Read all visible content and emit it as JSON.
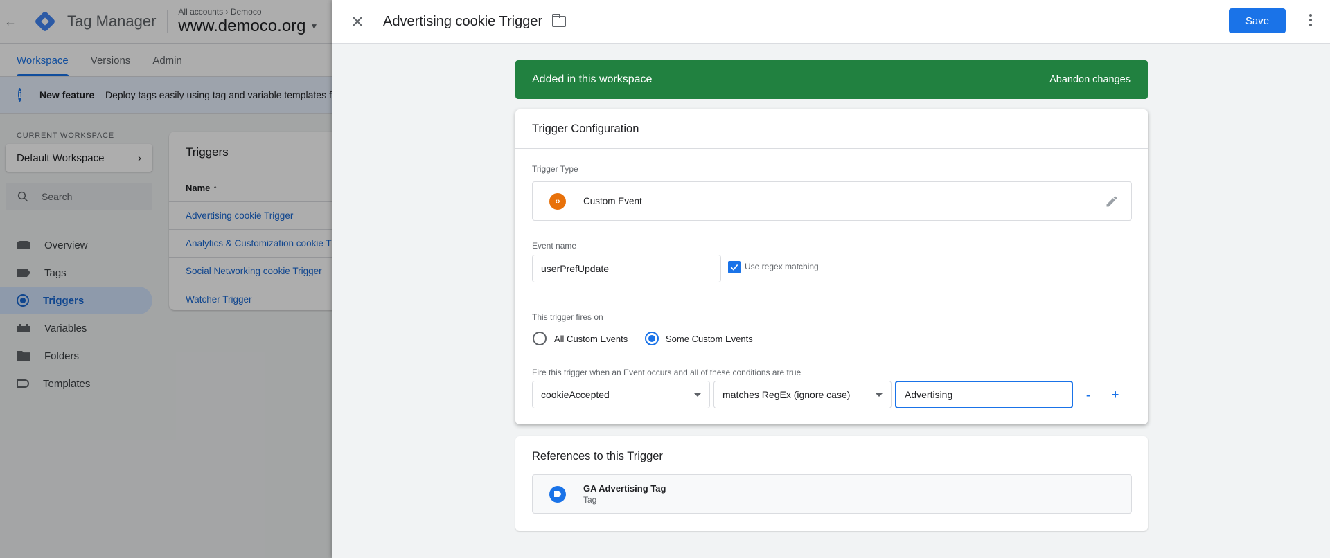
{
  "app": {
    "name": "Tag Manager",
    "breadcrumb": [
      "All accounts",
      "Democo"
    ],
    "container": "www.democo.org"
  },
  "nav_tabs": [
    {
      "label": "Workspace",
      "active": true
    },
    {
      "label": "Versions",
      "active": false
    },
    {
      "label": "Admin",
      "active": false
    }
  ],
  "banner": {
    "title": "New feature",
    "text": "– Deploy tags easily using tag and variable templates fr"
  },
  "workspace": {
    "section_label": "CURRENT WORKSPACE",
    "name": "Default Workspace"
  },
  "search": {
    "placeholder": "Search"
  },
  "sidebar": {
    "items": [
      {
        "label": "Overview",
        "icon": "overview-icon",
        "active": false
      },
      {
        "label": "Tags",
        "icon": "tag-icon",
        "active": false
      },
      {
        "label": "Triggers",
        "icon": "trigger-icon",
        "active": true
      },
      {
        "label": "Variables",
        "icon": "variables-icon",
        "active": false
      },
      {
        "label": "Folders",
        "icon": "folder-icon",
        "active": false
      },
      {
        "label": "Templates",
        "icon": "templates-icon",
        "active": false
      }
    ]
  },
  "triggers_list": {
    "title": "Triggers",
    "column_name": "Name",
    "sort_icon": "arrow-up-icon",
    "rows": [
      "Advertising cookie Trigger",
      "Analytics & Customization cookie Tr",
      "Social Networking cookie Trigger",
      "Watcher Trigger"
    ]
  },
  "panel": {
    "title": "Advertising cookie Trigger",
    "save_label": "Save",
    "status": {
      "text": "Added in this workspace",
      "action": "Abandon changes",
      "color": "#218140"
    },
    "config": {
      "title": "Trigger Configuration",
      "trigger_type_label": "Trigger Type",
      "trigger_type": "Custom Event",
      "event_name_label": "Event name",
      "event_name": "userPrefUpdate",
      "regex_label": "Use regex matching",
      "regex_checked": true,
      "fires_on_label": "This trigger fires on",
      "fires_on_options": [
        {
          "label": "All Custom Events",
          "checked": false
        },
        {
          "label": "Some Custom Events",
          "checked": true
        }
      ],
      "conditions_label": "Fire this trigger when an Event occurs and all of these conditions are true",
      "condition": {
        "variable": "cookieAccepted",
        "operator": "matches RegEx (ignore case)",
        "value": "Advertising"
      },
      "remove_label": "-",
      "add_label": "+"
    },
    "references": {
      "title": "References to this Trigger",
      "items": [
        {
          "name": "GA Advertising Tag",
          "type": "Tag"
        }
      ]
    }
  },
  "colors": {
    "accent": "#1a73e8",
    "success": "#218140",
    "custom_event": "#e8710a"
  }
}
